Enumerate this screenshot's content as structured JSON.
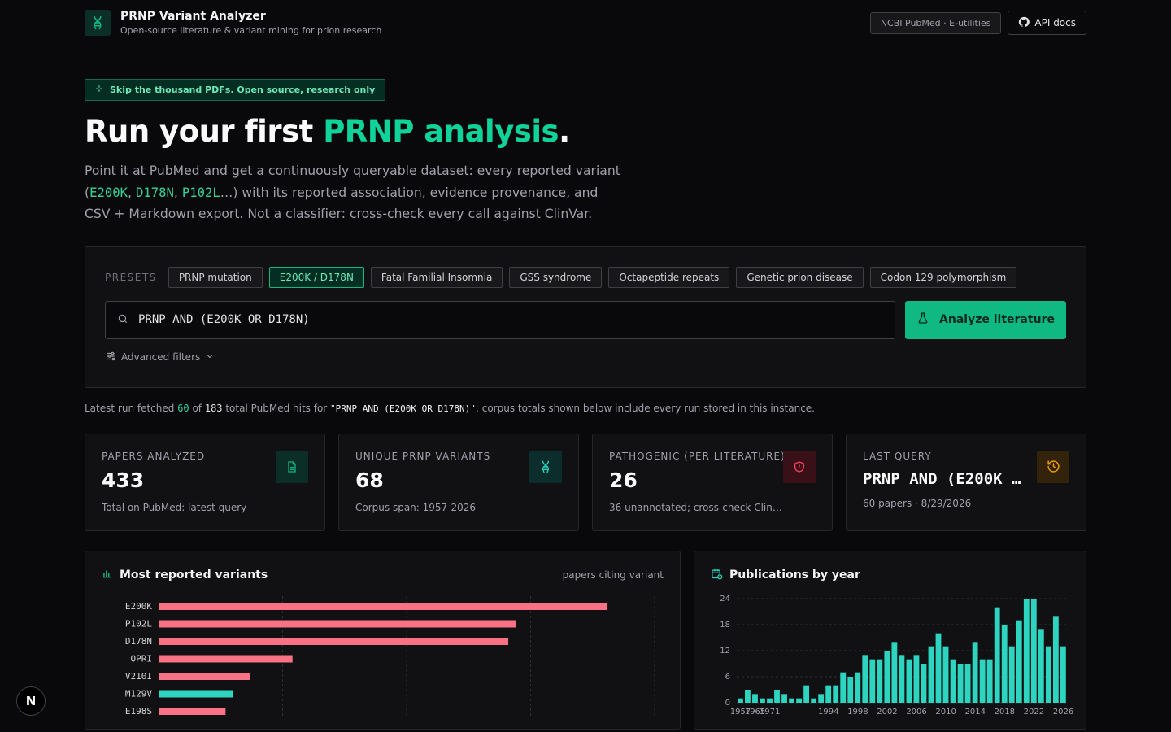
{
  "header": {
    "title": "PRNP Variant Analyzer",
    "subtitle": "Open-source literature & variant mining for prion research",
    "source_pill": "NCBI PubMed · E-utilities",
    "api_docs": "API docs"
  },
  "hero": {
    "tag": "Skip the thousand PDFs. Open source, research only",
    "title_start": "Run your first ",
    "title_accent": "PRNP analysis",
    "title_end": ".",
    "lede_1": "Point it at PubMed and get a continuously queryable dataset: every reported variant (",
    "lede_v1": "E200K",
    "lede_sep1": ", ",
    "lede_v2": "D178N",
    "lede_sep2": ", ",
    "lede_v3": "P102L",
    "lede_2": "…) with its reported association, evidence provenance, and CSV + Markdown export. Not a classifier: cross-check every call against ClinVar."
  },
  "search": {
    "presets_label": "PRESETS",
    "presets": [
      {
        "label": "PRNP mutation",
        "active": false
      },
      {
        "label": "E200K / D178N",
        "active": true
      },
      {
        "label": "Fatal Familial Insomnia",
        "active": false
      },
      {
        "label": "GSS syndrome",
        "active": false
      },
      {
        "label": "Octapeptide repeats",
        "active": false
      },
      {
        "label": "Genetic prion disease",
        "active": false
      },
      {
        "label": "Codon 129 polymorphism",
        "active": false
      }
    ],
    "query": "PRNP AND (E200K OR D178N)",
    "analyze_label": "Analyze literature",
    "advanced_label": "Advanced filters"
  },
  "run_note": {
    "prefix": "Latest run fetched ",
    "fetched": "60",
    "of": " of ",
    "total": "183",
    "mid": " total PubMed hits for ",
    "query": "\"PRNP AND (E200K OR D178N)\"",
    "suffix": "; corpus totals shown below include every run stored in this instance."
  },
  "stats": [
    {
      "label": "PAPERS ANALYZED",
      "value": "433",
      "foot": "Total on PubMed: latest query",
      "icon": "document-icon",
      "color": "#10b981"
    },
    {
      "label": "UNIQUE PRNP VARIANTS",
      "value": "68",
      "foot": "Corpus span: 1957-2026",
      "icon": "dna-icon",
      "color": "#2dd4bf"
    },
    {
      "label": "PATHOGENIC (PER LITERATURE)",
      "value": "26",
      "foot": "36 unannotated; cross-check Clin…",
      "icon": "shield-alert-icon",
      "color": "#f43f5e"
    },
    {
      "label": "LAST QUERY",
      "value": "PRNP AND (E200K …",
      "foot": "60 papers · 8/29/2026",
      "icon": "history-icon",
      "color": "#f59e0b"
    }
  ],
  "colors": {
    "accent": "#10b981",
    "pathogenic_bar": "#f87185",
    "benign_bar": "#2dd4bf"
  },
  "chart_data": [
    {
      "type": "bar",
      "title": "Most reported variants",
      "subtitle": "papers citing variant",
      "orientation": "horizontal",
      "categories": [
        "E200K",
        "P102L",
        "D178N",
        "OPRI",
        "V210I",
        "M129V",
        "E198S"
      ],
      "values": [
        181,
        144,
        141,
        54,
        37,
        30,
        27
      ],
      "colors": [
        "#f87185",
        "#f87185",
        "#f87185",
        "#f87185",
        "#f87185",
        "#2dd4bf",
        "#f87185"
      ],
      "xlim": [
        0,
        200
      ],
      "grid": true
    },
    {
      "type": "bar",
      "title": "Publications by year",
      "categories": [
        "1957",
        "1961",
        "1965",
        "1968",
        "1971",
        "1974",
        "1977",
        "1980",
        "1983",
        "1986",
        "1989",
        "1992",
        "1994",
        "1995",
        "1996",
        "1997",
        "1998",
        "1999",
        "2000",
        "2001",
        "2002",
        "2003",
        "2004",
        "2005",
        "2006",
        "2007",
        "2008",
        "2009",
        "2010",
        "2011",
        "2012",
        "2013",
        "2014",
        "2015",
        "2016",
        "2017",
        "2018",
        "2019",
        "2020",
        "2021",
        "2022",
        "2023",
        "2024",
        "2025",
        "2026"
      ],
      "tick_labels": [
        "1957",
        "1965",
        "1971",
        "1994",
        "1998",
        "2002",
        "2006",
        "2010",
        "2014",
        "2018",
        "2022",
        "2026"
      ],
      "values": [
        1,
        3,
        2,
        1,
        1,
        3,
        2,
        1,
        1,
        4,
        1,
        2,
        4,
        4,
        7,
        6,
        7,
        11,
        10,
        10,
        12,
        14,
        11,
        10,
        11,
        9,
        13,
        16,
        13,
        10,
        9,
        9,
        14,
        10,
        10,
        22,
        18,
        13,
        19,
        24,
        24,
        17,
        13,
        20,
        13
      ],
      "yticks": [
        0,
        6,
        12,
        18,
        24
      ],
      "ylim": [
        0,
        24
      ],
      "grid": true
    }
  ]
}
